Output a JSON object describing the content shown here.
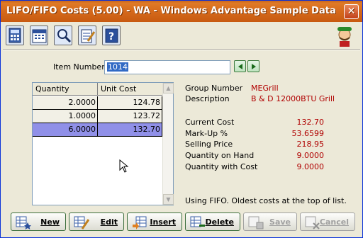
{
  "window": {
    "title": "LIFO/FIFO Costs (5.00) - WA - Windows Advantage Sample Data",
    "close_label": "✕"
  },
  "toolbar": {
    "icons": [
      "calculator-icon",
      "calendar-icon",
      "magnifier-icon",
      "notepad-icon",
      "help-icon"
    ]
  },
  "form": {
    "item_number_label": "Item Number",
    "item_number_value": "1014"
  },
  "grid": {
    "columns": [
      "Quantity",
      "Unit Cost"
    ],
    "rows": [
      {
        "quantity": "2.0000",
        "unit_cost": "124.78"
      },
      {
        "quantity": "1.0000",
        "unit_cost": "123.72"
      },
      {
        "quantity": "6.0000",
        "unit_cost": "132.70"
      }
    ],
    "selected_row": 2
  },
  "details": {
    "group_number_label": "Group Number",
    "group_number_value": "MEGrill",
    "description_label": "Description",
    "description_value": "B & D 12000BTU Grill",
    "current_cost_label": "Current Cost",
    "current_cost_value": "132.70",
    "markup_label": "Mark-Up %",
    "markup_value": "53.6599",
    "selling_price_label": "Selling Price",
    "selling_price_value": "218.95",
    "qty_on_hand_label": "Quantity on Hand",
    "qty_on_hand_value": "9.0000",
    "qty_with_cost_label": "Quantity with Cost",
    "qty_with_cost_value": "9.0000"
  },
  "note": "Using FIFO. Oldest costs at the top of list.",
  "buttons": {
    "new": "New",
    "edit": "Edit",
    "insert": "Insert",
    "delete": "Delete",
    "save": "Save",
    "cancel": "Cancel"
  },
  "colors": {
    "title_bar": "#d56a1c",
    "selected_row": "#9090e8",
    "value_text": "#b00000"
  }
}
